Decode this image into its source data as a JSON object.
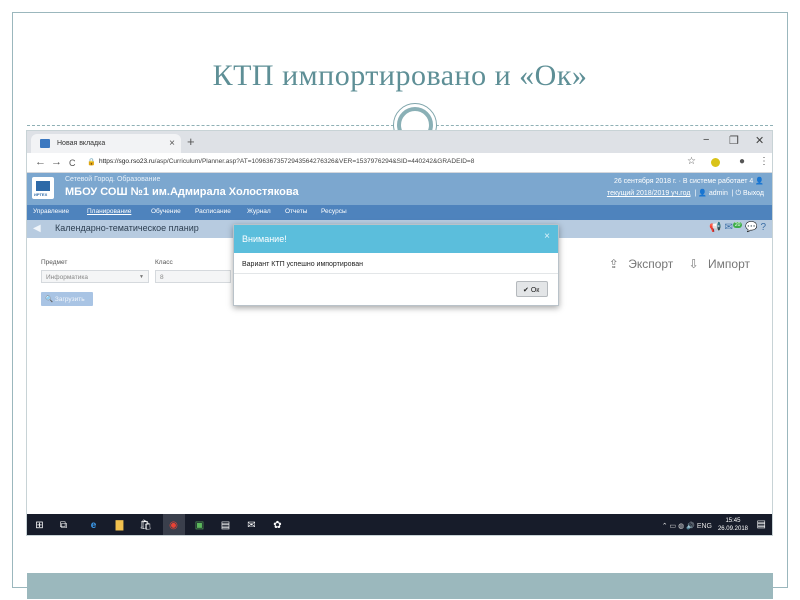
{
  "slide": {
    "title": "КТП импортировано и «Ок»"
  },
  "browser": {
    "tab_title": "Новая вкладка",
    "tab_close": "×",
    "new_tab": "+",
    "win_minimize": "−",
    "win_maximize": "❐",
    "win_close": "✕",
    "back": "←",
    "forward": "→",
    "reload": "C",
    "lock": "🔒",
    "url_host": "https://sgo.rso23.ru",
    "url_path": "/asp/Curriculum/Planner.asp?AT=10963673572943564276326&VER=1537976294&SID=440242&GRADEID=8",
    "star": "☆",
    "account": "●",
    "menu_dots": "⋮"
  },
  "app": {
    "logo_text": "ИРТЕХ",
    "brand": "Сетевой Город. Образование",
    "school": "МБОУ СОШ №1 им.Адмирала Холостякова",
    "date_line": "26 сентября 2018 г. · В системе работает 4",
    "year_line": "текущий 2018/2019 уч.год",
    "user": "admin",
    "logout": "Выход",
    "menu": [
      {
        "label": "Управление",
        "active": false
      },
      {
        "label": "Планирование",
        "active": true
      },
      {
        "label": "Обучение",
        "active": false
      },
      {
        "label": "Расписание",
        "active": false
      },
      {
        "label": "Журнал",
        "active": false
      },
      {
        "label": "Отчеты",
        "active": false
      },
      {
        "label": "Ресурсы",
        "active": false
      }
    ],
    "page_title": "Календарно-тематическое планир",
    "badge_count": "20",
    "subject_label": "Предмет",
    "subject_value": "Информатика",
    "class_label": "Класс",
    "class_value": "8",
    "load_button": "Загрузить",
    "export_label": "Экспорт",
    "import_label": "Импорт"
  },
  "modal": {
    "title": "Внимание!",
    "close": "×",
    "message": "Вариант КТП успешно импортирован",
    "ok_label": "Ок"
  },
  "taskbar": {
    "lang": "ENG",
    "time": "15:45",
    "date": "26.09.2018"
  },
  "colors": {
    "header": "#7ca7cf",
    "menu": "#4e83bd",
    "modal_header": "#5bbedc",
    "slide_accent": "#5e8f96"
  }
}
